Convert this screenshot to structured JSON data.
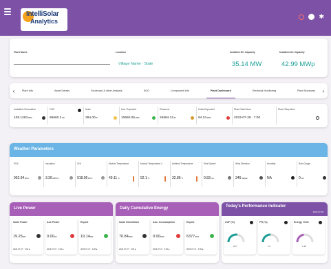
{
  "app": {
    "logo": {
      "line1": "IntelliSolar",
      "line2": "Analytics",
      "sub": "",
      "sun_color": "#f6a21c"
    },
    "header_icons": [
      "alert-icon",
      "user-icon",
      "settings-icon"
    ],
    "accent": "#7d52a6",
    "teal": "#1b9e97"
  },
  "plant_info": {
    "name_label": "Plant Name",
    "name_value": "",
    "location_label": "Location",
    "location_value": "Village Name · State",
    "dc_label": "Installed DC Capacity",
    "dc_value": "35.14 MW",
    "ac_label": "Installed AC Capacity",
    "ac_value": "42.99 MWp"
  },
  "tabs": {
    "items": [
      "Plant Info",
      "Asset Details",
      "Scorecard & other Analysis",
      "SOD",
      "Component Info",
      "Plant Dashboard",
      "Electrical Monitoring",
      "Plant Summary"
    ],
    "active": "Plant Dashboard"
  },
  "stats": [
    {
      "label": "Installed Generation",
      "value": "108.1263",
      "unit": "MWh",
      "icon": "lightning-icon",
      "icon_color": "#333"
    },
    {
      "label": "CUF",
      "value": "86660.2",
      "unit": "kW",
      "icon": "info-icon",
      "icon_color": "#222"
    },
    {
      "label": "Irrad.",
      "value": "394.00",
      "unit": "W",
      "icon": "sun-icon",
      "icon_color": "#f0c247"
    },
    {
      "label": "Inst. Exported",
      "value": "10660.05",
      "unit": "MWh",
      "icon": "plug-icon",
      "icon_color": "#3bb54a"
    },
    {
      "label": "Revenue",
      "value": "25684.12",
      "unit": "60",
      "icon": "rupee-icon",
      "icon_color": "#d49b2f"
    },
    {
      "label": "Units Exported",
      "value": "94.34",
      "unit": "MWh",
      "icon": "alert-icon",
      "icon_color": "#e03b3b"
    },
    {
      "label": "Plant Start time",
      "value": "2023-07-28 · 7:00",
      "unit": "",
      "icon": "clock-icon",
      "icon_color": "#333"
    },
    {
      "label": "Plant Stop time",
      "value": "",
      "unit": "",
      "icon": "clock-icon",
      "icon_color": "#333"
    }
  ],
  "weather": {
    "title": "Weather Parameters",
    "cells": [
      {
        "label": "POA",
        "value": "952.94",
        "unit": "W/m²",
        "icon": "sun-icon"
      },
      {
        "label": "Insolation",
        "value": "3.36",
        "unit": "kWh/m²",
        "icon": "sun-icon"
      },
      {
        "label": "GHI",
        "value": "918.06",
        "unit": "W/m²",
        "icon": "sun-icon"
      },
      {
        "label": "Module Temperature",
        "value": "49.11",
        "unit": "°C",
        "icon": "thermometer-icon"
      },
      {
        "label": "Module Temperature 2",
        "value": "52.1",
        "unit": "°C",
        "icon": "thermometer-icon"
      },
      {
        "label": "Ambient Temperature",
        "value": "32.86",
        "unit": "°C",
        "icon": "thermometer-icon"
      },
      {
        "label": "Wind Speed",
        "value": "0.83",
        "unit": "m/s",
        "icon": "wind-icon"
      },
      {
        "label": "Wind Direction",
        "value": "346",
        "unit": "Degree",
        "icon": "compass-icon"
      },
      {
        "label": "Humidity",
        "value": "NA",
        "unit": "",
        "icon": "drop-icon"
      },
      {
        "label": "Rain Gauge",
        "value": "0",
        "unit": "mm",
        "icon": "rain-icon"
      }
    ]
  },
  "live_power": {
    "title": "Live Power",
    "items": [
      {
        "label": "Solar Power",
        "value": "19.25",
        "unit": "MW",
        "time": "2023-07-27 · 3:00 ▸",
        "dot": "#333"
      },
      {
        "label": "Aux Power",
        "value": "0.00",
        "unit": "kW",
        "time": "2023-07-27 · 3:00 ▸",
        "dot": "#e03b3b"
      },
      {
        "label": "Export",
        "value": "19.14",
        "unit": "MW",
        "time": "2023-07-27 · 3:00 ▸",
        "dot": "#3bb54a"
      }
    ]
  },
  "daily_energy": {
    "title": "Daily Cumulative Energy",
    "items": [
      {
        "label": "Solar Generation",
        "value": "70.84",
        "unit": "MWh",
        "time": "2023-07-27 · 3:00 ▸",
        "dot": "#333"
      },
      {
        "label": "Aux. Consumption",
        "value": "0.00",
        "unit": "MWh",
        "time": "2023-07-27 · 3:00 ▸",
        "dot": "#e03b3b"
      },
      {
        "label": "Export",
        "value": "6377",
        "unit": "MWh",
        "time": "2023-07-27 · 3:00 ▸",
        "dot": "#3bb54a"
      }
    ]
  },
  "performance": {
    "title": "Today's Performance Indicator",
    "date": "2023-07-28",
    "gauges": [
      {
        "label": "CUF (%)",
        "value": "227",
        "fraction": 0.55,
        "color": "#1b9e97"
      },
      {
        "label": "PR (%)",
        "value": "1.6",
        "fraction": 0.5,
        "color": "#1b9e97"
      },
      {
        "label": "Energy Yield",
        "value": "1.43",
        "fraction": 0.45,
        "color": "#a85fb8"
      }
    ]
  }
}
